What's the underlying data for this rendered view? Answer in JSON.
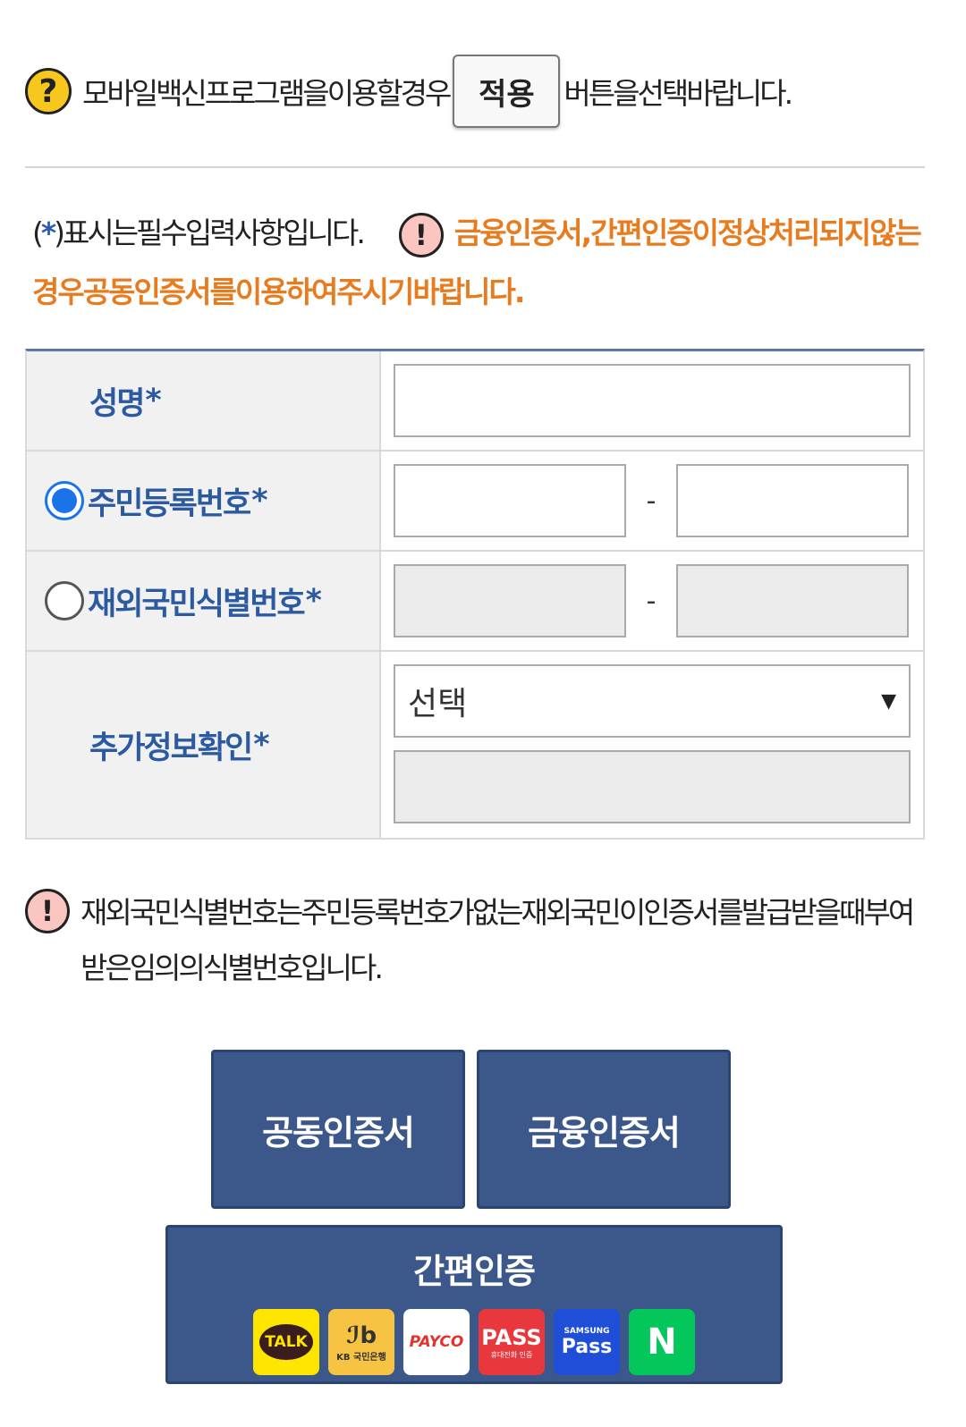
{
  "top_notice": {
    "text_before": "모바일백신프로그램을이용할경우",
    "apply_button": "적용",
    "text_after": "버튼을선택바랍니다."
  },
  "required_notice": {
    "prefix": "(",
    "star": "*",
    "suffix": ")표시는필수입력사항입니다.",
    "warning": "금융인증서,간편인증이정상처리되지않는경우공동인증서를이용하여주시기바랍니다."
  },
  "form": {
    "name_label": "성명",
    "rrn_label": "주민등록번호",
    "foreign_label": "재외국민식별번호",
    "extra_label": "추가정보확인",
    "required_mark": "*",
    "dash": "-",
    "select_value": "선택",
    "select_arrow": "▼"
  },
  "info_notice": "재외국민식별번호는주민등록번호가없는재외국민이인증서를발급받을때부여받은임의의식별번호입니다.",
  "buttons": {
    "joint_cert": "공동인증서",
    "financial_cert": "금융인증서",
    "simple_auth": "간편인증"
  },
  "providers": [
    {
      "label": "TALK",
      "icon": "kakaotalk-icon"
    },
    {
      "label": "KB 국민은행",
      "icon": "kb-bank-icon"
    },
    {
      "label": "PAYCO",
      "icon": "payco-icon"
    },
    {
      "label": "PASS",
      "sub": "휴대전화 인증",
      "icon": "pass-icon"
    },
    {
      "label": "Pass",
      "sub": "SAMSUNG",
      "icon": "samsung-pass-icon"
    },
    {
      "label": "N",
      "icon": "naver-icon"
    }
  ],
  "colors": {
    "primary_button": "#3c588b",
    "label_text": "#2c5aa0",
    "warning_text": "#e87b1e",
    "radio_checked": "#1a73e8"
  }
}
